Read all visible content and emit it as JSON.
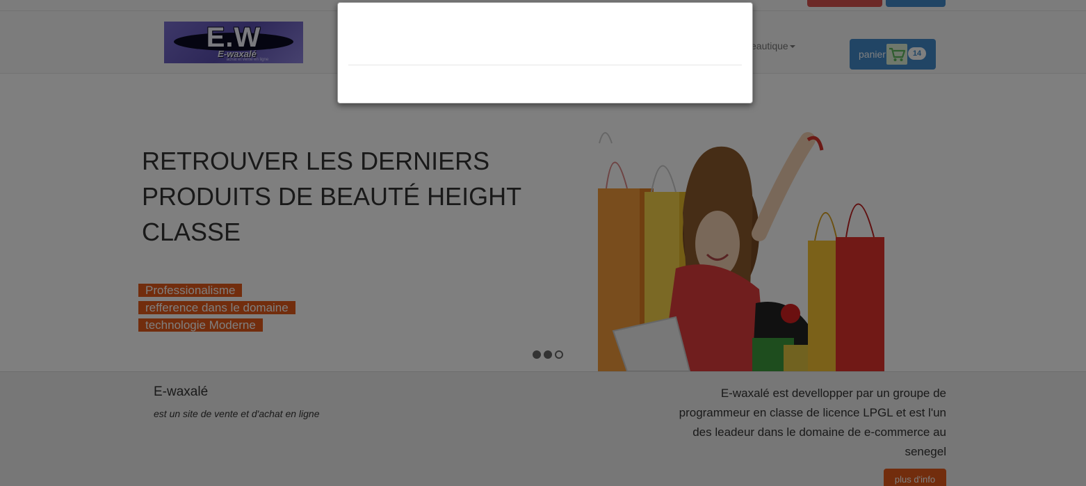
{
  "navbar": {
    "logo": {
      "mark": "E.W",
      "name": "E-waxalé",
      "tagline": "achat et vente en ligne"
    },
    "dropdown_label": "eautique",
    "cart": {
      "label": "panier",
      "count": "14"
    }
  },
  "hero": {
    "title": "RETROUVER LES DERNIERS PRODUITS DE BEAUTÉ HEIGHT CLASSE",
    "tags": [
      "Professionalisme",
      "refference dans le domaine",
      "technologie Moderne"
    ],
    "carousel": {
      "slides": 3,
      "active_index": 2
    }
  },
  "footer": {
    "site_name": "E-waxalé",
    "site_tagline": "est un site de vente et d'achat en ligne",
    "about": "E-waxalé est devellopper par un groupe de programmeur en classe de licence LPGL et est l'un des leadeur dans le domaine de e-commerce au senegel",
    "info_button": "plus d'info"
  },
  "colors": {
    "accent_orange": "#e55a1b",
    "primary_blue": "#428bca",
    "danger_red": "#d9534f",
    "backdrop": "rgba(0,0,0,0.5)"
  },
  "icons": [
    "shopping-cart-icon",
    "caret-down-icon"
  ]
}
